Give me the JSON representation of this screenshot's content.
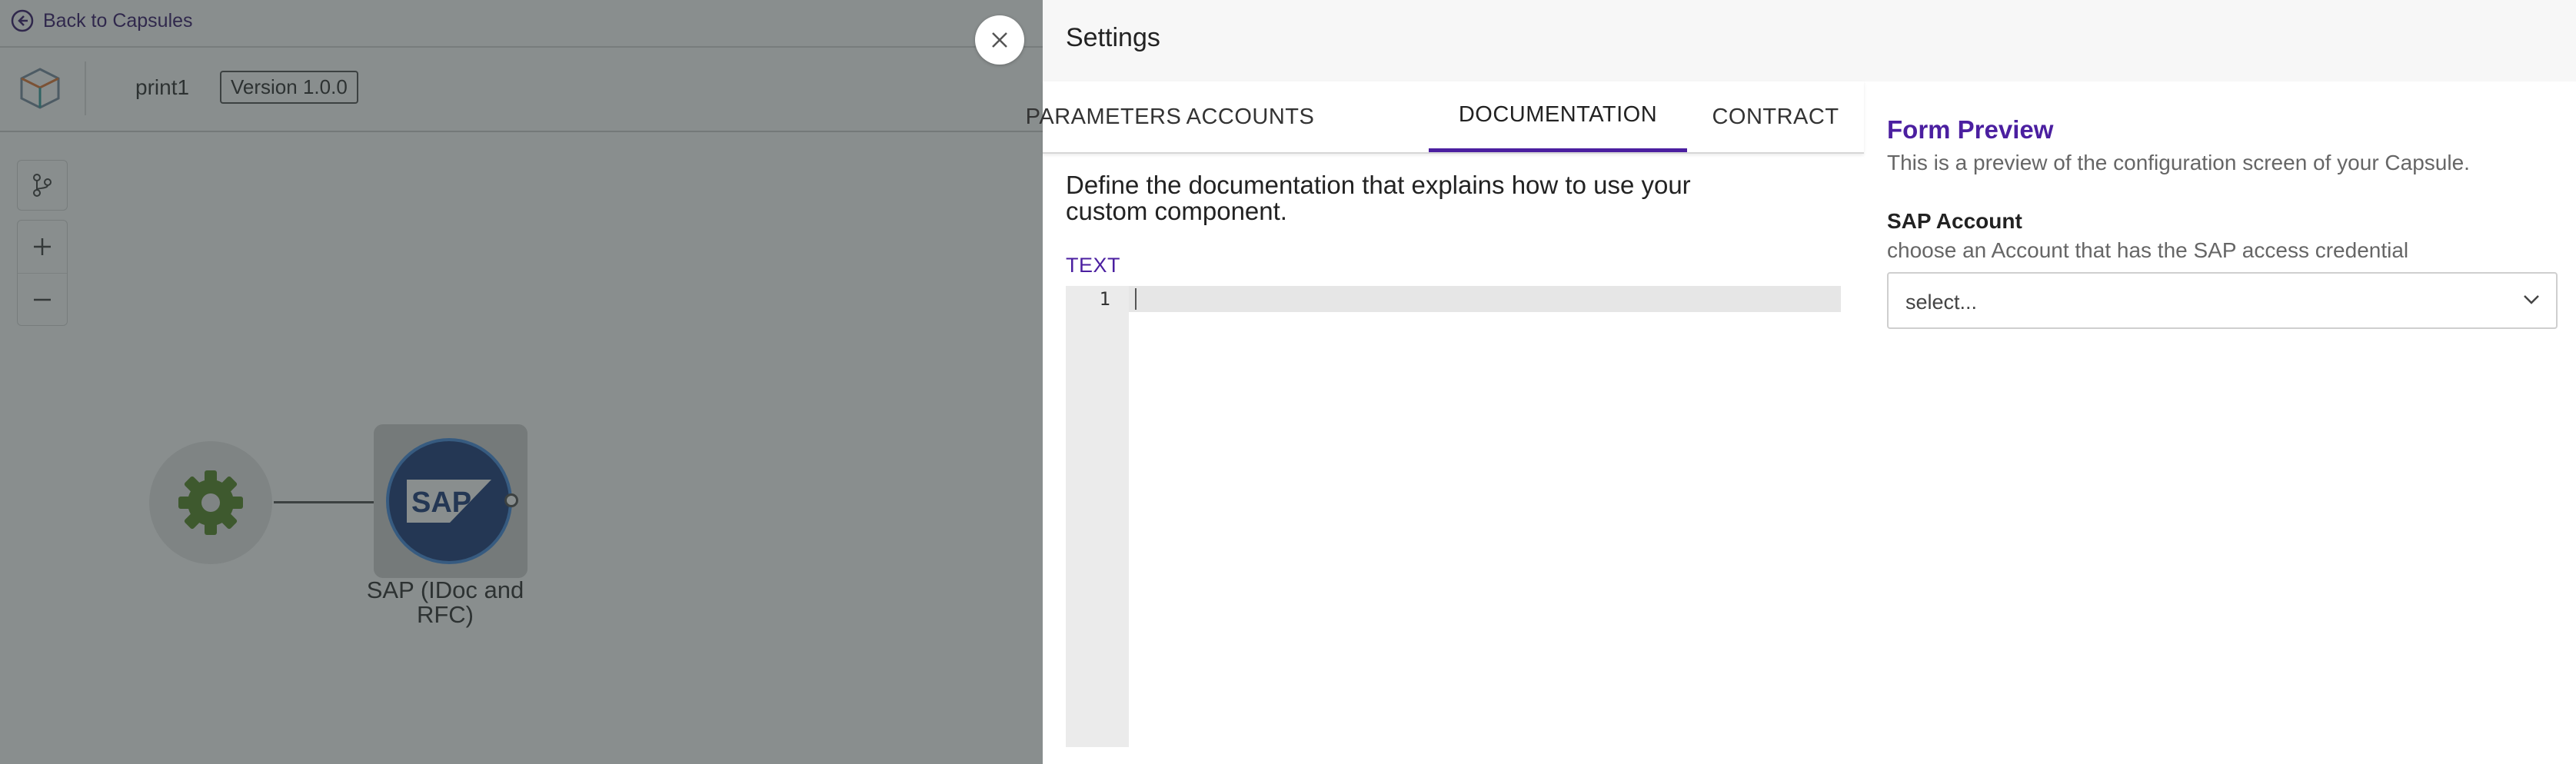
{
  "app": {
    "back_link": "Back to Capsules",
    "capsule_name": "print1",
    "version_badge": "Version 1.0.0",
    "canvas": {
      "trigger_node": "trigger-gear",
      "sap_node": {
        "icon_text": "SAP",
        "label": "SAP (IDoc and RFC)"
      }
    }
  },
  "settings": {
    "title": "Settings",
    "tabs": [
      {
        "label": "PARAMETERS",
        "active": false
      },
      {
        "label": "ACCOUNTS",
        "active": false
      },
      {
        "label": "DOCUMENTATION",
        "active": true
      },
      {
        "label": "CONTRACT",
        "active": false
      }
    ],
    "documentation": {
      "intro": "Define the documentation that explains how to use your custom component.",
      "text_label": "TEXT",
      "editor": {
        "line_numbers": [
          "1"
        ],
        "content": ""
      }
    },
    "form_preview": {
      "title": "Form Preview",
      "description": "This is a preview of the configuration screen of your Capsule.",
      "field_label": "SAP Account",
      "field_help": "choose an Account that has the SAP access credential",
      "select_value": "select..."
    }
  },
  "colors": {
    "accent": "#4b1fa0",
    "overlay": "#283232",
    "sap_blue": "#1f3f7f",
    "gear_green": "#5a8a2a"
  },
  "icons": [
    "back-arrow-icon",
    "capsule-logo-icon",
    "branch-icon",
    "zoom-in-icon",
    "zoom-out-icon",
    "gear-icon",
    "sap-logo-icon",
    "close-icon",
    "chevron-down-icon"
  ]
}
